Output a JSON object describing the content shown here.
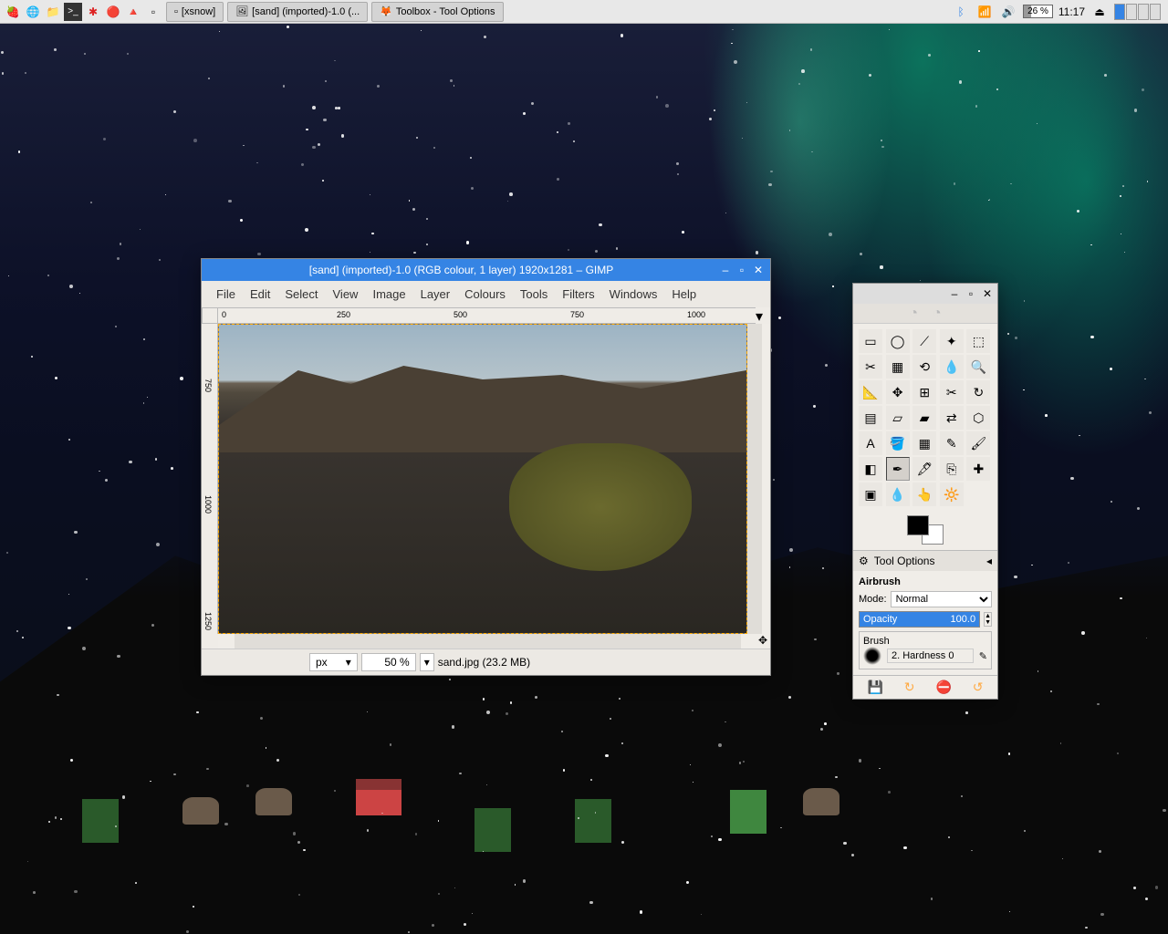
{
  "taskbar": {
    "tasks": [
      {
        "label": "[xsnow]"
      },
      {
        "label": "[sand] (imported)-1.0 (..."
      },
      {
        "label": "Toolbox - Tool Options"
      }
    ],
    "battery": "26 %",
    "clock": "11:17"
  },
  "gimp_window": {
    "title": "[sand] (imported)-1.0 (RGB colour, 1 layer) 1920x1281 – GIMP",
    "menus": [
      "File",
      "Edit",
      "Select",
      "View",
      "Image",
      "Layer",
      "Colours",
      "Tools",
      "Filters",
      "Windows",
      "Help"
    ],
    "ruler_h": [
      "0",
      "250",
      "500",
      "750",
      "1000"
    ],
    "ruler_v": [
      "750",
      "1000",
      "1250"
    ],
    "status": {
      "unit": "px",
      "zoom": "50 %",
      "filename": "sand.jpg (23.2 MB)"
    }
  },
  "toolbox": {
    "tools": [
      "rect-select",
      "ellipse-select",
      "free-select",
      "fuzzy-select",
      "color-select",
      "scissors",
      "fg-select",
      "paths",
      "color-picker",
      "zoom",
      "measure",
      "move",
      "align",
      "crop",
      "rotate",
      "scale",
      "shear",
      "perspective",
      "flip",
      "cage",
      "text",
      "bucket",
      "blend",
      "pencil",
      "paintbrush",
      "eraser",
      "airbrush",
      "ink",
      "clone",
      "heal",
      "perspective-clone",
      "blur",
      "smudge",
      "dodge",
      ""
    ],
    "tool_glyphs": [
      "▭",
      "◯",
      "⟋",
      "✦",
      "⬚",
      "✂",
      "▦",
      "⟲",
      "💧",
      "🔍",
      "📐",
      "✥",
      "⊞",
      "✂",
      "↻",
      "▤",
      "▱",
      "▰",
      "⇄",
      "⬡",
      "A",
      "🪣",
      "▦",
      "✎",
      "🖌",
      "◧",
      "✒",
      "🖋",
      "⎘",
      "✚",
      "▣",
      "💧",
      "👆",
      "🔆",
      ""
    ],
    "selected_tool_index": 26,
    "options": {
      "header": "Tool Options",
      "tool_name": "Airbrush",
      "mode_label": "Mode:",
      "mode_value": "Normal",
      "opacity_label": "Opacity",
      "opacity_value": "100.0",
      "brush_label": "Brush",
      "brush_name": "2. Hardness 0"
    }
  }
}
